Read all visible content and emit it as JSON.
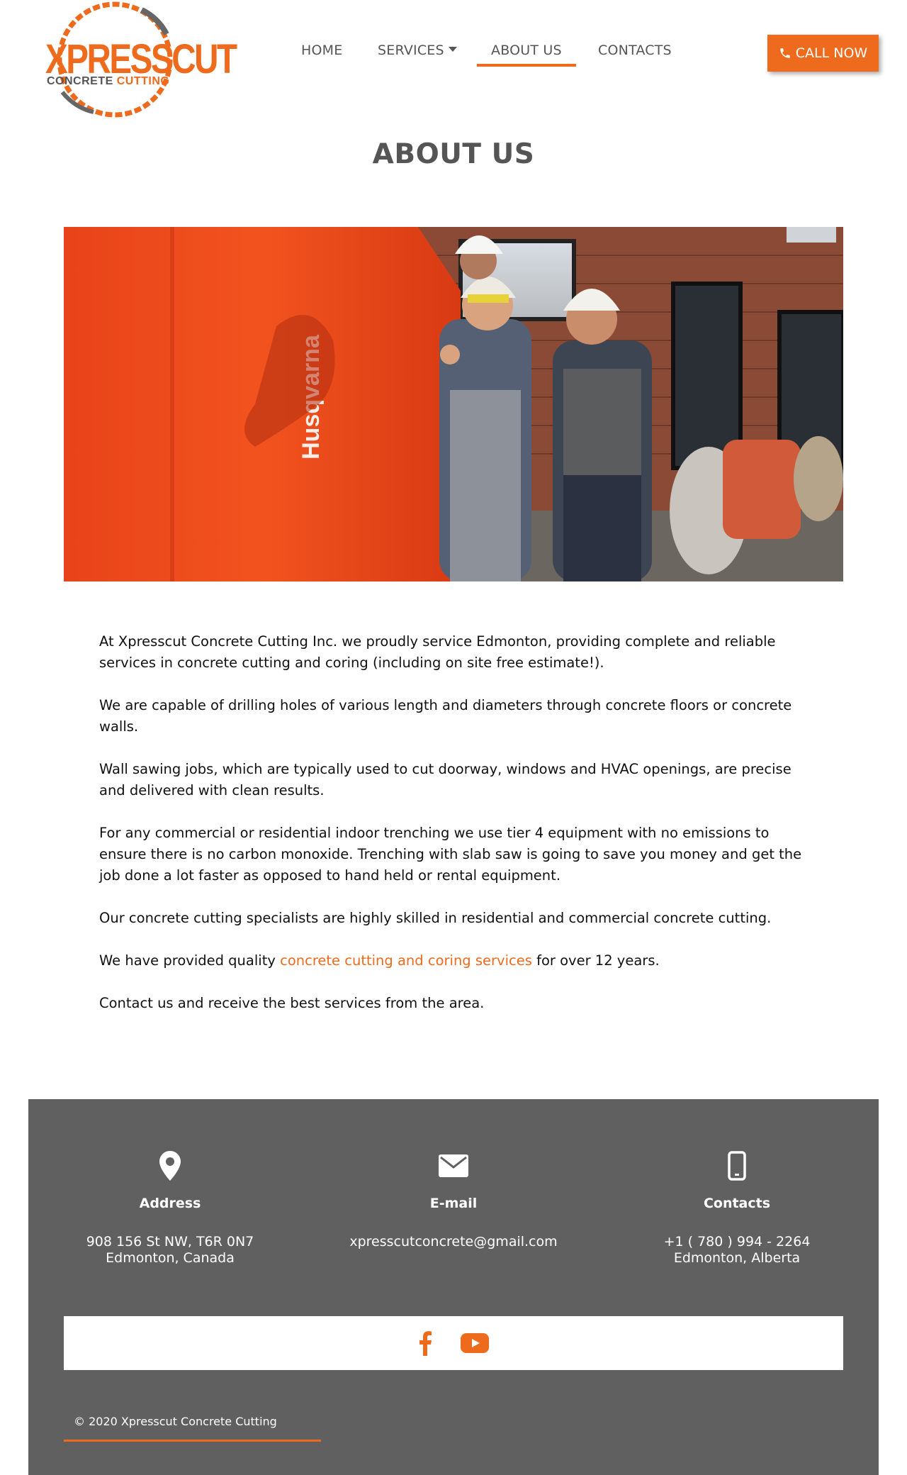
{
  "brand": {
    "logo_main": "XPRESSCUT",
    "logo_sub_1": "CONCRETE",
    "logo_sub_2": "CUTTING",
    "accent_color": "#ee6a1c",
    "footer_bg": "#606060"
  },
  "nav": {
    "items": [
      {
        "label": "HOME",
        "active": false
      },
      {
        "label": "SERVICES",
        "active": false,
        "icon": "caret-down-icon"
      },
      {
        "label": "ABOUT US",
        "active": true
      },
      {
        "label": "CONTACTS",
        "active": false
      }
    ],
    "call_button": "CALL NOW",
    "call_icon": "phone-icon"
  },
  "page": {
    "title": "ABOUT US",
    "hero_text": "Husqvarna"
  },
  "content": {
    "p1": "At Xpresscut Concrete Cutting Inc. we proudly service Edmonton, providing complete and reliable services in concrete cutting and coring (including on site free estimate!).",
    "p2": "We are capable of drilling holes of various length and diameters through concrete floors or concrete walls.",
    "p3": "Wall sawing jobs, which are typically used to cut doorway, windows and HVAC openings, are precise and delivered with clean results.",
    "p4": "For any commercial or residential indoor trenching we use tier 4 equipment with no emissions to ensure there is no carbon monoxide. Trenching with slab saw is going to save you money and get the job done a lot faster as opposed to hand held or rental equipment.",
    "p5": "Our concrete cutting specialists are highly skilled in residential and commercial concrete cutting.",
    "p6_before": "We have provided quality ",
    "p6_link": "concrete cutting and coring services",
    "p6_after": " for over 12 years.",
    "p7": "Contact us and receive the best services from the area."
  },
  "footer": {
    "address": {
      "title": "Address",
      "line1": "908 156 St NW, T6R 0N7",
      "line2": "Edmonton, Canada",
      "icon": "map-pin-icon"
    },
    "email": {
      "title": "E-mail",
      "line1": "xpresscutconcrete@gmail.com",
      "icon": "envelope-icon"
    },
    "contacts": {
      "title": "Contacts",
      "line1": "+1 ( 780 ) 994 - 2264",
      "line2": "Edmonton, Alberta",
      "icon": "mobile-phone-icon"
    },
    "social": [
      "facebook-icon",
      "youtube-icon"
    ],
    "copyright": "© 2020 Xpresscut Concrete Cutting"
  }
}
